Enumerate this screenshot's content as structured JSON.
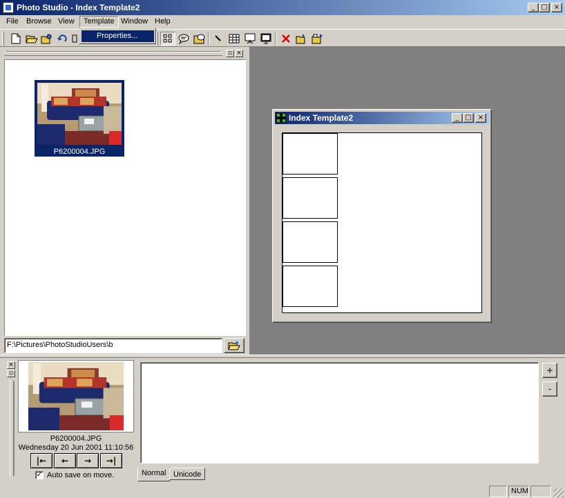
{
  "app": {
    "title": "Photo Studio - Index Template2",
    "window_buttons": {
      "minimize": "_",
      "maximize": "□",
      "close": "×"
    }
  },
  "menubar": {
    "items": [
      "File",
      "Browse",
      "View",
      "Template",
      "Window",
      "Help"
    ],
    "open_menu": "Template",
    "dropdown_item": "Properties..."
  },
  "toolbar": {
    "buttons": [
      "new-icon",
      "open-icon",
      "open-folder-icon",
      "undo-icon",
      "settings-icon",
      "grid-view-icon",
      "speech-bubble-icon",
      "caption-icon",
      "pencil-icon",
      "table-icon",
      "slideshow-icon",
      "monitor-icon",
      "delete-icon",
      "copy-to-folder-icon",
      "move-to-folder-icon"
    ]
  },
  "browser": {
    "thumbnail_caption": "P6200004.JPG",
    "path": "F:\\Pictures\\PhotoStudioUsers\\b"
  },
  "child_window": {
    "title": "Index Template2",
    "frame_count": 4
  },
  "preview": {
    "file_name": "P6200004.JPG",
    "date": "Wednesday 20 Jun 2001 11:10:56",
    "nav_buttons": [
      "|←",
      "←",
      "→",
      "→|"
    ],
    "autosave_label": "Auto save on move.",
    "autosave_checked": true
  },
  "editor": {
    "text": "",
    "tabs": [
      "Normal",
      "Unicode"
    ],
    "active_tab": "Normal",
    "side_buttons": [
      "+",
      "-"
    ]
  },
  "statusbar": {
    "num_indicator": "NUM"
  },
  "colors": {
    "title_active": "#0a246a",
    "face": "#d4d0c8",
    "mdi_background": "#808080"
  }
}
